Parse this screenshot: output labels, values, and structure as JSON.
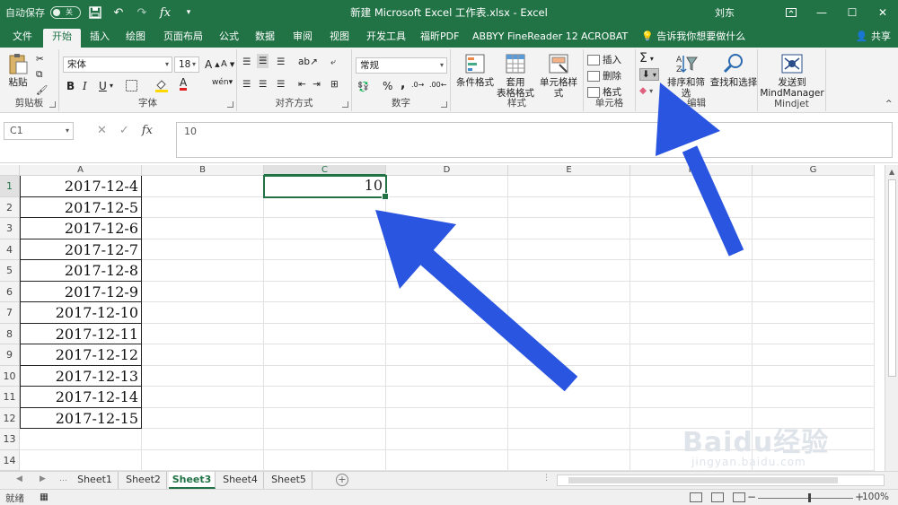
{
  "titlebar": {
    "autosave_label": "自动保存",
    "autosave_state": "关",
    "title": "新建 Microsoft Excel 工作表.xlsx  -  Excel",
    "user": "刘东"
  },
  "ribbon_tabs": [
    "文件",
    "开始",
    "插入",
    "绘图",
    "页面布局",
    "公式",
    "数据",
    "审阅",
    "视图",
    "开发工具",
    "福昕PDF",
    "ABBYY FineReader 12",
    "ACROBAT"
  ],
  "active_tab": "开始",
  "tell_me": "告诉我你想要做什么",
  "share": "共享",
  "ribbon": {
    "clipboard": {
      "label": "剪贴板",
      "paste": "粘贴"
    },
    "font": {
      "label": "字体",
      "font_name": "宋体",
      "font_size": "18",
      "bold": "B",
      "italic": "I",
      "underline": "U"
    },
    "alignment": {
      "label": "对齐方式"
    },
    "number": {
      "label": "数字",
      "format": "常规",
      "percent": "%",
      "comma": ","
    },
    "styles": {
      "label": "样式",
      "conditional": "条件格式",
      "table_format_1": "套用",
      "table_format_2": "表格格式",
      "cell_styles": "单元格样式"
    },
    "cells": {
      "label": "单元格",
      "insert": "插入",
      "delete": "删除",
      "format": "格式"
    },
    "editing": {
      "label": "编辑",
      "sort_filter": "排序和筛选",
      "find_select": "查找和选择"
    },
    "mindjet": {
      "label": "Mindjet",
      "send_1": "发送到",
      "send_2": "MindManager"
    }
  },
  "formula_bar": {
    "name_box": "C1",
    "formula": "10"
  },
  "columns": [
    "A",
    "B",
    "C",
    "D",
    "E",
    "F",
    "G"
  ],
  "rows": [
    "1",
    "2",
    "3",
    "4",
    "5",
    "6",
    "7",
    "8",
    "9",
    "10",
    "11",
    "12",
    "13",
    "14"
  ],
  "column_a_values": [
    "2017-12-4",
    "2017-12-5",
    "2017-12-6",
    "2017-12-7",
    "2017-12-8",
    "2017-12-9",
    "2017-12-10",
    "2017-12-11",
    "2017-12-12",
    "2017-12-13",
    "2017-12-14",
    "2017-12-15"
  ],
  "active_cell": {
    "ref": "C1",
    "value": "10"
  },
  "sheets": [
    "Sheet1",
    "Sheet2",
    "Sheet3",
    "Sheet4",
    "Sheet5"
  ],
  "active_sheet": "Sheet3",
  "status": {
    "ready": "就绪",
    "zoom": "100%"
  },
  "colors": {
    "brand": "#217346",
    "arrow": "#2a55e0"
  },
  "watermark": {
    "logo": "Baidu经验",
    "url": "jingyan.baidu.com"
  }
}
